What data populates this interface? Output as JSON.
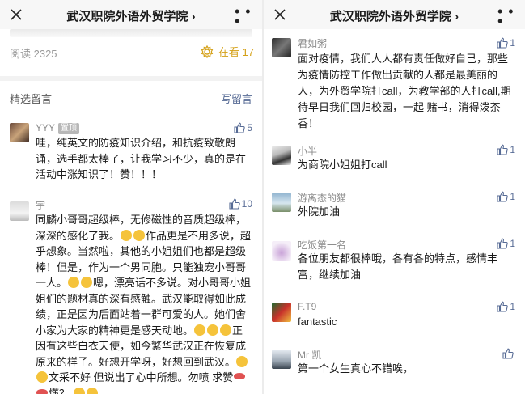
{
  "nav": {
    "title": "武汉职院外语外贸学院",
    "title_chevron": "›"
  },
  "left": {
    "read_count": "阅读 2325",
    "zaikan_label": "在看 17",
    "comments_label": "精选留言",
    "write_label": "写留言",
    "comments": [
      {
        "name": "YYY",
        "badge": "置顶",
        "likes": "5",
        "text": "哇，纯英文的防疫知识介绍，和抗疫致敬朗诵，选手都太棒了，让我学习不少，真的是在活动中涨知识了！赞！！！"
      },
      {
        "name": "宇",
        "likes": "10",
        "text_parts": [
          "同麟小哥哥超级棒，无修磁性的音质超级棒，深深的感化了我。",
          "作品更是不用多说，超乎想象。当然啦，其他的小姐姐们也都是超级棒！但是，作为一个男同胞。只能独宠小哥哥一人。",
          "嗯，漂亮话不多说。对小哥哥小姐姐们的题材真的深有感触。武汉能取得如此成绩，正是因为后面站着一群可爱的人。她们舍小家为大家的精神更是感天动地。",
          "正因有这些白衣天使，如今繁华武汉正在恢复成原来的样子。好想开学呀，好想回到武汉。",
          "文采不好 但说出了心中所想。勿喷 求赞",
          "懂？"
        ]
      }
    ]
  },
  "right": {
    "comments": [
      {
        "name": "君如粥",
        "likes": "1",
        "text": "面对疫情，我们人人都有责任做好自己，那些为疫情防控工作做出贡献的人都是最美丽的人，为外贸学院打call，为教学部的人打call,期待早日我们回归校园，一起 赌书，消得泼茶香！"
      },
      {
        "name": "小半",
        "likes": "1",
        "text": "为商院小姐姐打call"
      },
      {
        "name": "游离态的猫",
        "likes": "1",
        "text": "外院加油"
      },
      {
        "name": "吃饭第一名",
        "likes": "1",
        "text": "各位朋友都很棒哦，各有各的特点，感情丰富，继续加油"
      },
      {
        "name": "F.T9",
        "likes": "1",
        "text": "fantastic"
      },
      {
        "name": "Mr 凯",
        "likes": "",
        "text": "第一个女生真心不错唉，"
      }
    ]
  },
  "colors": {
    "link": "#576b95",
    "zaikan": "#d4a017",
    "muted": "#8c8c8c"
  }
}
